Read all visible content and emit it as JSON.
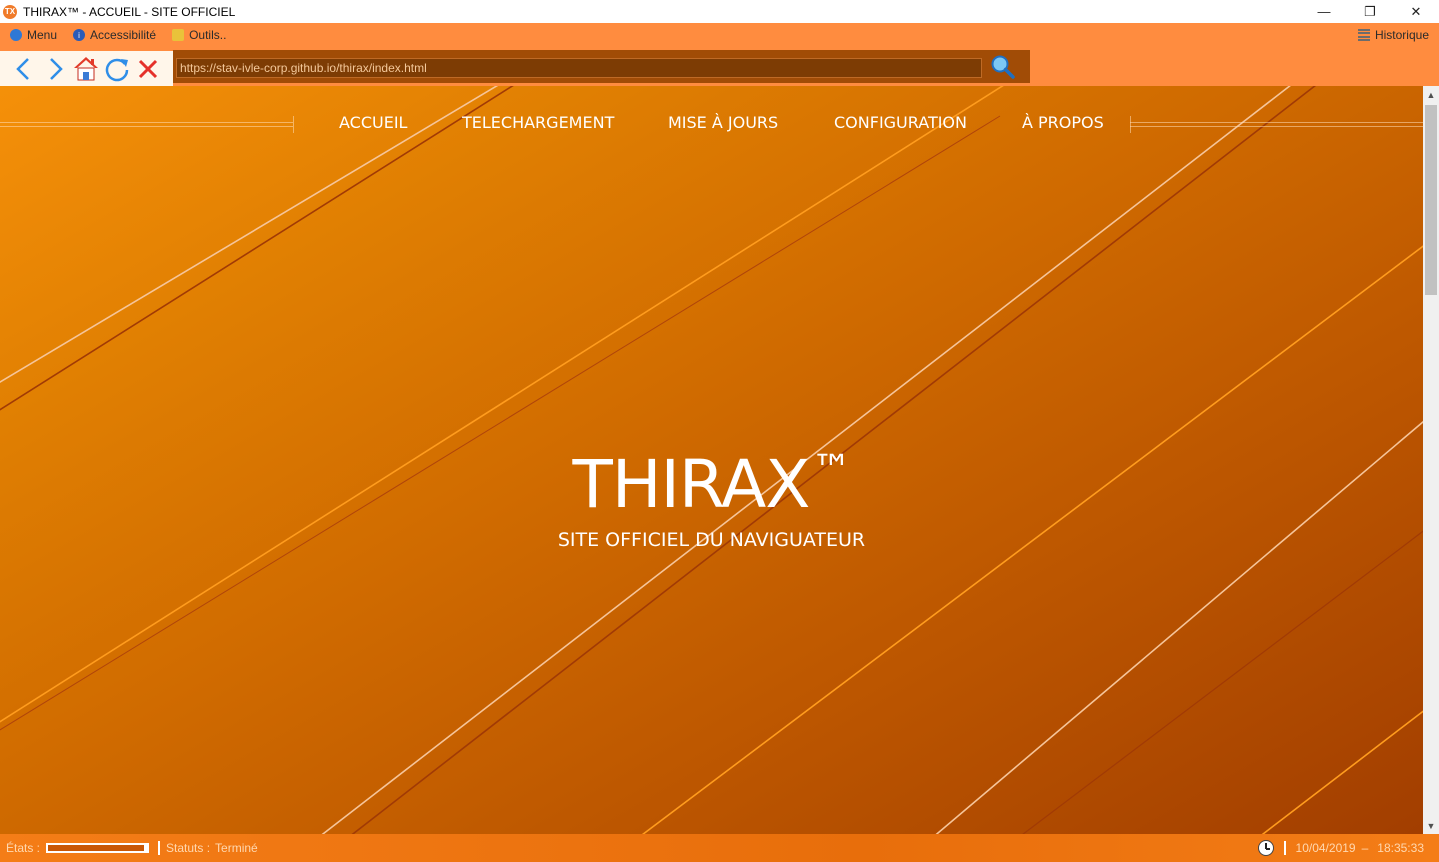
{
  "window": {
    "title": "THIRAX™ - ACCUEIL - SITE OFFICIEL",
    "app_icon_text": "TX",
    "controls": {
      "minimize": "—",
      "restore": "❐",
      "close": "✕"
    }
  },
  "menubar": {
    "items": [
      {
        "label": "Menu",
        "icon": "menu-icon"
      },
      {
        "label": "Accessibilité",
        "icon": "accessibility-icon"
      },
      {
        "label": "Outils..",
        "icon": "tools-icon"
      }
    ],
    "history_label": "Historique"
  },
  "toolbar": {
    "url": "https://stav-ivle-corp.github.io/thirax/index.html",
    "buttons": [
      "back-icon",
      "forward-icon",
      "home-icon",
      "refresh-icon",
      "stop-icon",
      "search-icon"
    ]
  },
  "page": {
    "nav": [
      "ACCUEIL",
      "TELECHARGEMENT",
      "MISE À JOURS",
      "CONFIGURATION",
      "À PROPOS"
    ],
    "hero_title": "THIRAX",
    "hero_tm": "™",
    "hero_subtitle": "SITE OFFICIEL DU NAVIGUATEUR"
  },
  "statusbar": {
    "etats_label": "États :",
    "progress": 0.97,
    "statuts_label": "Statuts :",
    "statuts_value": "Terminé",
    "date": "10/04/2019",
    "dash": "–",
    "time": "18:35:33"
  },
  "colors": {
    "chrome_orange": "#ff8c3f",
    "url_bg": "#7d3c04",
    "content_top": "#f59009",
    "content_bottom": "#a23e00"
  }
}
